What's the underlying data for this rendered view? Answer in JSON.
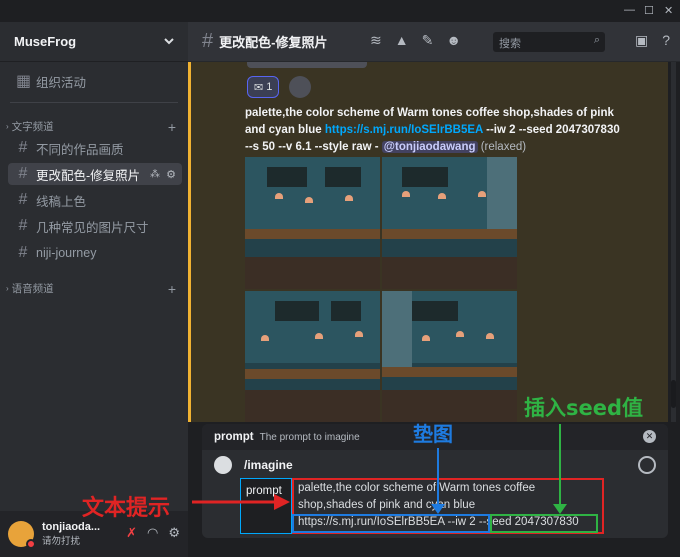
{
  "sidebar": {
    "server_name": "MuseFrog",
    "top_channel": "组织活动",
    "category_text": "文字频道",
    "channels": [
      "不同的作品画质",
      "更改配色-修复照片",
      "线稿上色",
      "几种常见的图片尺寸",
      "niji-journey"
    ],
    "category_voice": "语音频道"
  },
  "user": {
    "name": "tonjiaoda...",
    "status": "请勿打扰"
  },
  "header": {
    "channel_title": "更改配色-修复照片",
    "search_placeholder": "搜索"
  },
  "message": {
    "reaction_count": "1",
    "text_part1": "palette,the color scheme of Warm tones coffee shop,shades of pink and cyan blue ",
    "link": "https://s.mj.run/IoSElrBB5EA",
    "text_part2": " --iw 2 --seed 2047307830 --s 50 --v 6.1 --style raw - ",
    "mention": "@tonjiaodawang",
    "suffix": " (relaxed)"
  },
  "composer": {
    "option_name": "prompt",
    "option_desc": "The prompt to imagine",
    "command": "/imagine",
    "option_label": "prompt",
    "prompt_value": "palette,the color scheme of Warm tones coffee shop,shades of pink and cyan blue",
    "prompt_link": "https://s.mj.run/IoSElrBB5EA --iw 2",
    "prompt_seed": " --seed 2047307830"
  },
  "annotations": {
    "seed": "插入seed值",
    "pad": "垫图",
    "text": "文本提示"
  },
  "colors": {
    "accent_blue": "#00a8fc",
    "red": "#e02424",
    "green": "#2fb344",
    "blue": "#1e7be0",
    "highlight_bar": "#f0b232"
  }
}
